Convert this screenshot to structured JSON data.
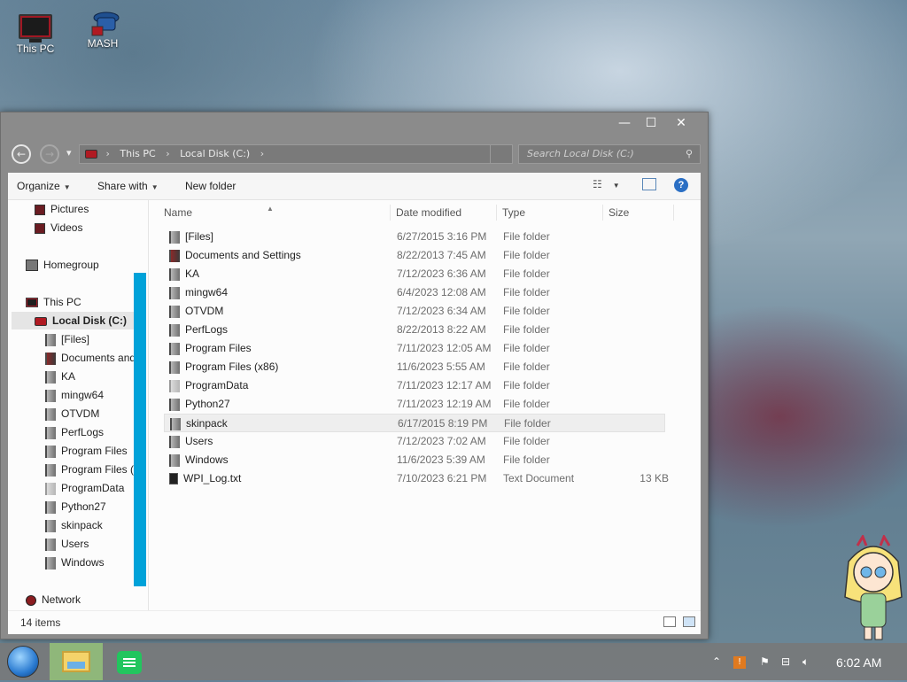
{
  "desktop": {
    "icons": [
      {
        "label": "This PC",
        "icon": "computer-icon"
      },
      {
        "label": "MASH",
        "icon": "mash-icon"
      }
    ]
  },
  "window": {
    "controls": {
      "minimize": "—",
      "maximize": "☐",
      "close": "✕"
    },
    "nav": {
      "back": "←",
      "forward": "→",
      "recent": "▾"
    },
    "breadcrumb": [
      "This PC",
      "Local Disk (C:)"
    ],
    "search_placeholder": "Search Local Disk (C:)",
    "toolbar": {
      "organize": "Organize",
      "share_with": "Share with",
      "new_folder": "New folder"
    },
    "columns": {
      "name": "Name",
      "date": "Date modified",
      "type": "Type",
      "size": "Size"
    },
    "nav_pane": {
      "pictures": "Pictures",
      "videos": "Videos",
      "homegroup": "Homegroup",
      "this_pc": "This PC",
      "local_disk": "Local Disk (C:)",
      "folders": [
        "[Files]",
        "Documents and",
        "KA",
        "mingw64",
        "OTVDM",
        "PerfLogs",
        "Program Files",
        "Program Files (x",
        "ProgramData",
        "Python27",
        "skinpack",
        "Users",
        "Windows"
      ],
      "network": "Network"
    },
    "files": [
      {
        "name": "[Files]",
        "date": "6/27/2015 3:16 PM",
        "type": "File folder",
        "size": ""
      },
      {
        "name": "Documents and Settings",
        "date": "8/22/2013 7:45 AM",
        "type": "File folder",
        "size": ""
      },
      {
        "name": "KA",
        "date": "7/12/2023 6:36 AM",
        "type": "File folder",
        "size": ""
      },
      {
        "name": "mingw64",
        "date": "6/4/2023 12:08 AM",
        "type": "File folder",
        "size": ""
      },
      {
        "name": "OTVDM",
        "date": "7/12/2023 6:34 AM",
        "type": "File folder",
        "size": ""
      },
      {
        "name": "PerfLogs",
        "date": "8/22/2013 8:22 AM",
        "type": "File folder",
        "size": ""
      },
      {
        "name": "Program Files",
        "date": "7/11/2023 12:05 AM",
        "type": "File folder",
        "size": ""
      },
      {
        "name": "Program Files (x86)",
        "date": "11/6/2023 5:55 AM",
        "type": "File folder",
        "size": ""
      },
      {
        "name": "ProgramData",
        "date": "7/11/2023 12:17 AM",
        "type": "File folder",
        "size": ""
      },
      {
        "name": "Python27",
        "date": "7/11/2023 12:19 AM",
        "type": "File folder",
        "size": ""
      },
      {
        "name": "skinpack",
        "date": "6/17/2015 8:19 PM",
        "type": "File folder",
        "size": ""
      },
      {
        "name": "Users",
        "date": "7/12/2023 7:02 AM",
        "type": "File folder",
        "size": ""
      },
      {
        "name": "Windows",
        "date": "11/6/2023 5:39 AM",
        "type": "File folder",
        "size": ""
      },
      {
        "name": "WPI_Log.txt",
        "date": "7/10/2023 6:21 PM",
        "type": "Text Document",
        "size": "13 KB"
      }
    ],
    "status": {
      "item_count": "14 items"
    }
  },
  "taskbar": {
    "clock": "6:02 AM",
    "tray_icons": [
      "chevron-up-icon",
      "notification-icon",
      "flag-icon",
      "network-icon",
      "volume-icon"
    ]
  }
}
